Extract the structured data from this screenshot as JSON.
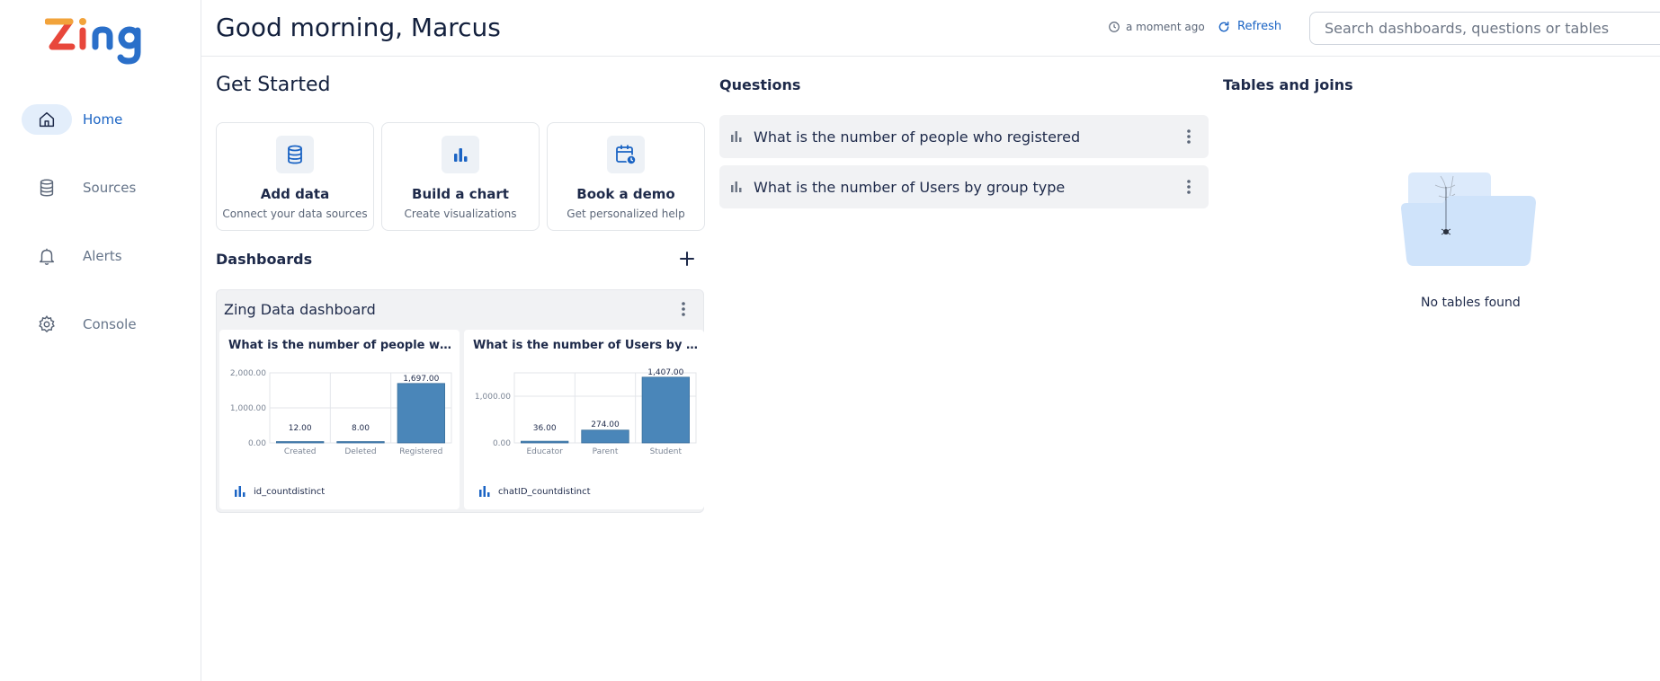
{
  "app": {
    "logo_text": "Zing"
  },
  "sidebar": {
    "items": [
      {
        "label": "Home",
        "icon": "home-icon",
        "active": true
      },
      {
        "label": "Sources",
        "icon": "database-icon",
        "active": false
      },
      {
        "label": "Alerts",
        "icon": "bell-icon",
        "active": false
      },
      {
        "label": "Console",
        "icon": "gear-icon",
        "active": false
      }
    ]
  },
  "header": {
    "greeting": "Good morning, Marcus",
    "updated": "a moment ago",
    "refresh_label": "Refresh",
    "search_placeholder": "Search dashboards, questions or tables"
  },
  "get_started": {
    "title": "Get Started",
    "cards": [
      {
        "title": "Add data",
        "subtitle": "Connect your data sources",
        "icon": "database-icon"
      },
      {
        "title": "Build a chart",
        "subtitle": "Create visualizations",
        "icon": "bar-chart-icon"
      },
      {
        "title": "Book a demo",
        "subtitle": "Get personalized help",
        "icon": "calendar-clock-icon"
      }
    ]
  },
  "dashboards": {
    "title": "Dashboards",
    "items": [
      {
        "name": "Zing Data dashboard",
        "tiles": [
          {
            "title": "What is the number of people who r...",
            "metric": "id_countdistinct"
          },
          {
            "title": "What is the number of Users by gro...",
            "metric": "chatID_countdistinct"
          }
        ]
      }
    ]
  },
  "questions": {
    "title": "Questions",
    "items": [
      {
        "text": "What is the number of people who registered"
      },
      {
        "text": "What is the number of Users by group type"
      }
    ]
  },
  "tables": {
    "title": "Tables and joins",
    "empty_text": "No tables found"
  },
  "colors": {
    "accent": "#1b64c4",
    "bar": "#4a86b9",
    "text": "#1e2a4a"
  },
  "chart_data": [
    {
      "type": "bar",
      "title": "What is the number of people who r...",
      "categories": [
        "Created",
        "Deleted",
        "Registered"
      ],
      "values": [
        12,
        8,
        1697
      ],
      "value_labels": [
        "12.00",
        "8.00",
        "1,697.00"
      ],
      "y_ticks": [
        "0.00",
        "1,000.00",
        "2,000.00"
      ],
      "y_tick_values": [
        0,
        1000,
        2000
      ],
      "ylim": [
        0,
        2000
      ],
      "legend": "id_countdistinct",
      "grid": true
    },
    {
      "type": "bar",
      "title": "What is the number of Users by gro...",
      "categories": [
        "Educator",
        "Parent",
        "Student"
      ],
      "values": [
        36,
        274,
        1407
      ],
      "value_labels": [
        "36.00",
        "274.00",
        "1,407.00"
      ],
      "y_ticks": [
        "0.00",
        "1,000.00"
      ],
      "y_tick_values": [
        0,
        1000
      ],
      "ylim": [
        0,
        1500
      ],
      "legend": "chatID_countdistinct",
      "grid": true
    }
  ]
}
